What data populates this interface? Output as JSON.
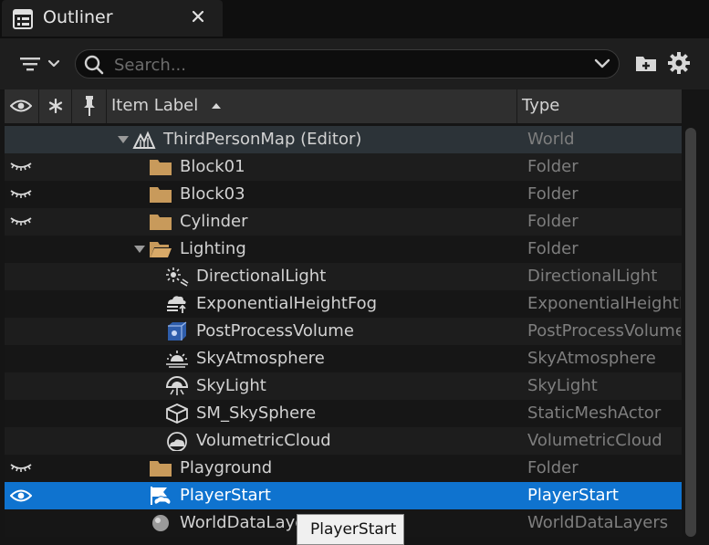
{
  "tab": {
    "title": "Outliner"
  },
  "search": {
    "placeholder": "Search..."
  },
  "columns": {
    "label": "Item Label",
    "type": "Type"
  },
  "rows": [
    {
      "label": "ThirdPersonMap (Editor)",
      "type": "World",
      "icon": "world-icon",
      "visibility": "none",
      "expanded": true
    },
    {
      "label": "Block01",
      "type": "Folder",
      "icon": "folder-icon",
      "visibility": "hidden"
    },
    {
      "label": "Block03",
      "type": "Folder",
      "icon": "folder-icon",
      "visibility": "hidden"
    },
    {
      "label": "Cylinder",
      "type": "Folder",
      "icon": "folder-icon",
      "visibility": "hidden"
    },
    {
      "label": "Lighting",
      "type": "Folder",
      "icon": "folder-open-icon",
      "visibility": "none",
      "expanded": true
    },
    {
      "label": "DirectionalLight",
      "type": "DirectionalLight",
      "icon": "directional-light-icon",
      "visibility": "none"
    },
    {
      "label": "ExponentialHeightFog",
      "type": "ExponentialHeightFog",
      "icon": "height-fog-icon",
      "visibility": "none"
    },
    {
      "label": "PostProcessVolume",
      "type": "PostProcessVolume",
      "icon": "post-process-volume-icon",
      "visibility": "none"
    },
    {
      "label": "SkyAtmosphere",
      "type": "SkyAtmosphere",
      "icon": "sky-atmosphere-icon",
      "visibility": "none"
    },
    {
      "label": "SkyLight",
      "type": "SkyLight",
      "icon": "sky-light-icon",
      "visibility": "none"
    },
    {
      "label": "SM_SkySphere",
      "type": "StaticMeshActor",
      "icon": "static-mesh-icon",
      "visibility": "none"
    },
    {
      "label": "VolumetricCloud",
      "type": "VolumetricCloud",
      "icon": "volumetric-cloud-icon",
      "visibility": "none"
    },
    {
      "label": "Playground",
      "type": "Folder",
      "icon": "folder-icon",
      "visibility": "hidden"
    },
    {
      "label": "PlayerStart",
      "type": "PlayerStart",
      "icon": "player-start-icon",
      "visibility": "visible",
      "selected": true
    },
    {
      "label": "WorldDataLayers",
      "type": "WorldDataLayers",
      "icon": "world-data-layers-icon",
      "visibility": "none"
    }
  ],
  "tooltip": {
    "text": "PlayerStart"
  },
  "colors": {
    "selection": "#0f73cf",
    "folder": "#c89a5b",
    "background": "#151515"
  }
}
